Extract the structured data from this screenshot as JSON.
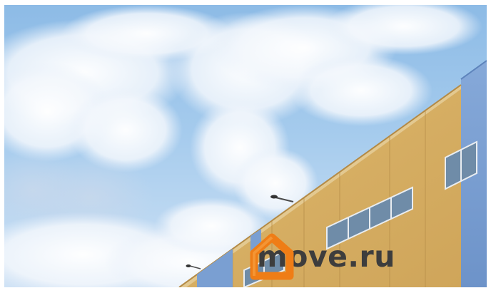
{
  "photo": {
    "subject": "industrial-warehouse-facade",
    "logo_icon": "house-outline-icon"
  },
  "brand": {
    "text": "move.ru"
  },
  "colors": {
    "sky_top": "#8dbbe6",
    "sky_bottom": "#cfe2f5",
    "facade_sand": "#d8b065",
    "facade_blue": "#7aa0d4",
    "logo_orange": "#ef7d16",
    "text_dark": "#3d3d3d"
  }
}
